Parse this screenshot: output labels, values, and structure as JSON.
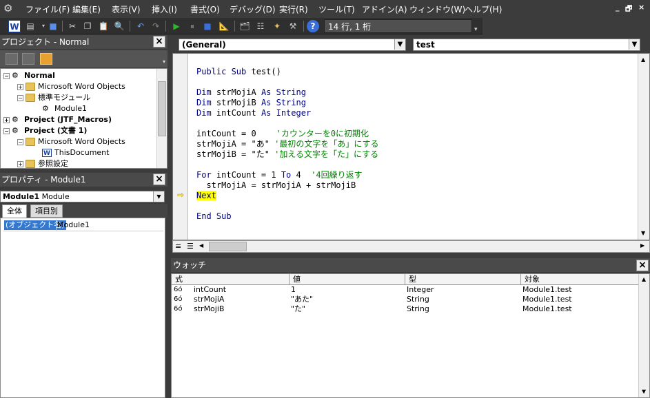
{
  "menu": {
    "items": [
      "ファイル(F)",
      "編集(E)",
      "表示(V)",
      "挿入(I)",
      "書式(O)",
      "デバッグ(D)",
      "実行(R)",
      "ツール(T)",
      "アドイン(A)",
      "ウィンドウ(W)",
      "ヘルプ(H)"
    ],
    "window_controls": [
      "_",
      "🗗",
      "×"
    ]
  },
  "toolbar": {
    "position": "14 行, 1 桁"
  },
  "project": {
    "title": "プロジェクト - Normal",
    "tree": [
      {
        "label": "Normal",
        "bold": true,
        "expander": "−"
      },
      {
        "label": "Microsoft Word Objects",
        "bold": false,
        "expander": "+"
      },
      {
        "label": "標準モジュール",
        "bold": false,
        "expander": "−"
      },
      {
        "label": "Module1",
        "bold": false,
        "expander": ""
      },
      {
        "label": "Project (JTF_Macros)",
        "bold": true,
        "expander": "+"
      },
      {
        "label": "Project (文書 1)",
        "bold": true,
        "expander": "−"
      },
      {
        "label": "Microsoft Word Objects",
        "bold": false,
        "expander": "−"
      },
      {
        "label": "ThisDocument",
        "bold": false,
        "expander": ""
      },
      {
        "label": "参照設定",
        "bold": false,
        "expander": "+"
      }
    ]
  },
  "properties": {
    "title": "プロパティ - Module1",
    "object_name": "Module1",
    "object_type": "Module",
    "tabs": [
      "全体",
      "項目別"
    ],
    "prop_name": "(オブジェクト名)",
    "prop_value": "Module1"
  },
  "code": {
    "object_combo": "(General)",
    "proc_combo": "test",
    "lines": [
      {
        "kw": "Public Sub ",
        "rest": "test()"
      },
      {
        "kw": "",
        "rest": ""
      },
      {
        "kw": "Dim ",
        "rest": "strMojiA ",
        "kw2": "As String"
      },
      {
        "kw": "Dim ",
        "rest": "strMojiB ",
        "kw2": "As String"
      },
      {
        "kw": "Dim ",
        "rest": "intCount ",
        "kw2": "As Integer"
      },
      {
        "kw": "",
        "rest": ""
      },
      {
        "kw": "",
        "rest": "intCount = 0    ",
        "comment": "'カウンターを0に初期化"
      },
      {
        "kw": "",
        "rest": "strMojiA = \"あ\" ",
        "comment": "'最初の文字を「あ」にする"
      },
      {
        "kw": "",
        "rest": "strMojiB = \"た\" ",
        "comment": "'加える文字を「た」にする"
      },
      {
        "kw": "",
        "rest": ""
      },
      {
        "kw": "For ",
        "rest": "intCount = 1 ",
        "kw2": "To ",
        "rest2": "4  ",
        "comment": "'4回繰り返す"
      },
      {
        "kw": "",
        "rest": "  strMojiA = strMojiA + strMojiB"
      },
      {
        "kw": "Next",
        "rest": "",
        "highlight": true
      },
      {
        "kw": "",
        "rest": ""
      },
      {
        "kw": "End Sub",
        "rest": ""
      }
    ]
  },
  "watch": {
    "title": "ウォッチ",
    "columns": [
      "式",
      "値",
      "型",
      "対象"
    ],
    "rows": [
      [
        "intCount",
        "1",
        "Integer",
        "Module1.test"
      ],
      [
        "strMojiA",
        "\"あた\"",
        "String",
        "Module1.test"
      ],
      [
        "strMojiB",
        "\"た\"",
        "String",
        "Module1.test"
      ]
    ]
  },
  "icons": {
    "glasses": "watch-glasses-icon",
    "arrow": "current-line-arrow-icon"
  },
  "colors": {
    "keyword": "#00008b",
    "comment": "#008000",
    "highlight": "#ffff00",
    "selection": "#3478d0"
  }
}
